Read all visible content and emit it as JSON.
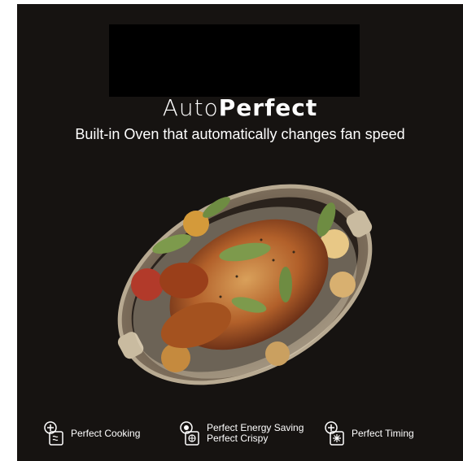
{
  "header": {
    "title_light": "Auto",
    "title_bold": "Perfect",
    "subtitle": "Built-in Oven that automatically changes fan speed"
  },
  "features": [
    {
      "icon": "fan-cooking-icon",
      "label": "Perfect Cooking"
    },
    {
      "icon": "energy-saving-icon",
      "label_line1": "Perfect Energy Saving",
      "label_line2": "Perfect Crispy"
    },
    {
      "icon": "timer-icon",
      "label": "Perfect Timing"
    }
  ],
  "colors": {
    "background": "#161311",
    "text": "#ffffff"
  }
}
